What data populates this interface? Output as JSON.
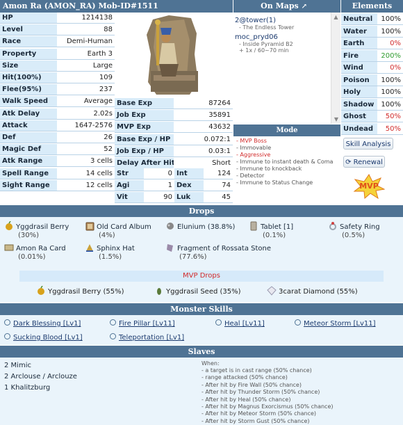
{
  "header": {
    "title": "Amon Ra   (AMON_RA)   Mob-ID#1511",
    "maps_label": "On Maps",
    "elements_label": "Elements"
  },
  "stats_left": [
    {
      "label": "HP",
      "value": "1214138"
    },
    {
      "label": "Level",
      "value": "88"
    },
    {
      "label": "Race",
      "value": "Demi-Human"
    },
    {
      "label": "Property",
      "value": "Earth 3"
    },
    {
      "label": "Size",
      "value": "Large"
    },
    {
      "label": "Hit(100%)",
      "value": "109"
    },
    {
      "label": "Flee(95%)",
      "value": "237"
    },
    {
      "label": "Walk Speed",
      "value": "Average"
    },
    {
      "label": "Atk Delay",
      "value": "2.02s"
    },
    {
      "label": "Attack",
      "value": "1647-2576"
    },
    {
      "label": "Def",
      "value": "26"
    },
    {
      "label": "Magic Def",
      "value": "52"
    },
    {
      "label": "Atk Range",
      "value": "3 cells"
    },
    {
      "label": "Spell Range",
      "value": "14 cells"
    },
    {
      "label": "Sight Range",
      "value": "12 cells"
    }
  ],
  "stats_mid": [
    {
      "label": "Base Exp",
      "value": "87264"
    },
    {
      "label": "Job Exp",
      "value": "35891"
    },
    {
      "label": "MVP Exp",
      "value": "43632"
    },
    {
      "label": "Base Exp / HP",
      "value": "0.072:1"
    },
    {
      "label": "Job Exp / HP",
      "value": "0.03:1"
    },
    {
      "label": "Delay After Hit",
      "value": "Short"
    }
  ],
  "attributes": [
    {
      "label": "Str",
      "value": "0",
      "label2": "Int",
      "value2": "124"
    },
    {
      "label": "Agi",
      "value": "1",
      "label2": "Dex",
      "value2": "74"
    },
    {
      "label": "Vit",
      "value": "90",
      "label2": "Luk",
      "value2": "45"
    }
  ],
  "maps": [
    {
      "name": "2@tower(1)",
      "sub": [
        "- The Endless Tower"
      ]
    },
    {
      "name": "moc_pryd06",
      "sub": [
        "- Inside Pyramid B2",
        "+ 1x / 60~70 min"
      ]
    }
  ],
  "mode": {
    "label": "Mode",
    "items": [
      {
        "text": "- MVP Boss",
        "red": true
      },
      {
        "text": "- Immovable",
        "red": false
      },
      {
        "text": "- Aggressive",
        "red": true
      },
      {
        "text": "- Immune to instant death & Coma",
        "red": false
      },
      {
        "text": "- Immune to knockback",
        "red": false
      },
      {
        "text": "- Detector",
        "red": false
      },
      {
        "text": "- Immune to Status Change",
        "red": false
      }
    ]
  },
  "elements": [
    {
      "name": "Neutral",
      "value": "100%",
      "color": "#222222"
    },
    {
      "name": "Water",
      "value": "100%",
      "color": "#222222"
    },
    {
      "name": "Earth",
      "value": "0%",
      "color": "#d12b2b"
    },
    {
      "name": "Fire",
      "value": "200%",
      "color": "#2e9b2e"
    },
    {
      "name": "Wind",
      "value": "0%",
      "color": "#d12b2b"
    },
    {
      "name": "Poison",
      "value": "100%",
      "color": "#222222"
    },
    {
      "name": "Holy",
      "value": "100%",
      "color": "#222222"
    },
    {
      "name": "Shadow",
      "value": "100%",
      "color": "#222222"
    },
    {
      "name": "Ghost",
      "value": "50%",
      "color": "#d12b2b"
    },
    {
      "name": "Undead",
      "value": "50%",
      "color": "#d12b2b"
    }
  ],
  "buttons": {
    "skill_analysis": "Skill Analysis",
    "renewal": "Renewal"
  },
  "mvp_badge": "MVP",
  "drops_label": "Drops",
  "drops": [
    {
      "name": "Yggdrasil Berry",
      "chance": "(30%)",
      "icon": "berry-icon"
    },
    {
      "name": "Old Card Album",
      "chance": "(4%)",
      "icon": "album-icon"
    },
    {
      "name": "Elunium (38.8%)",
      "chance": "",
      "icon": "ore-icon"
    },
    {
      "name": "Tablet [1]",
      "chance": "(0.1%)",
      "icon": "tablet-icon"
    },
    {
      "name": "Safety Ring",
      "chance": "(0.5%)",
      "icon": "ring-icon"
    },
    {
      "name": "Amon Ra Card",
      "chance": "(0.01%)",
      "icon": "card-icon"
    },
    {
      "name": "Sphinx Hat",
      "chance": "(1.5%)",
      "icon": "hat-icon"
    },
    {
      "name": "Fragment of Rossata Stone",
      "chance": "(77.6%)",
      "icon": "fragment-icon"
    }
  ],
  "mvp_drops_label": "MVP Drops",
  "mvp_drops": [
    {
      "name": "Yggdrasil Berry (55%)",
      "icon": "berry-icon"
    },
    {
      "name": "Yggdrasil Seed (35%)",
      "icon": "seed-icon"
    },
    {
      "name": "3carat Diamond (55%)",
      "icon": "diamond-icon"
    }
  ],
  "skills_label": "Monster Skills",
  "skills": [
    "Dark Blessing [Lv1]",
    "Fire Pillar [Lv11]",
    "Heal [Lv11]",
    "Meteor Storm [Lv11]",
    "Sucking Blood [Lv1]",
    "Teleportation [Lv1]"
  ],
  "slaves_label": "Slaves",
  "slaves": [
    "2 Mimic",
    "2 Arclouse / Arclouze",
    "1 Khalitzburg"
  ],
  "when": {
    "label": "When:",
    "items": [
      "- a target is in cast range (50% chance)",
      "- range attacked (50% chance)",
      "- After hit by Fire Wall (50% chance)",
      "- After hit by Thunder Storm (50% chance)",
      "- After hit by Heal (50% chance)",
      "- After hit by Magnus Exorcismus (50% chance)",
      "- After hit by Meteor Storm (50% chance)",
      "- After hit by Storm Gust (50% chance)"
    ]
  },
  "colors": {
    "header": "#4f7394",
    "label_bg": "#d9ecf9",
    "section_bg": "#eaf4fb",
    "red": "#d12b2b",
    "green": "#2e9b2e"
  }
}
